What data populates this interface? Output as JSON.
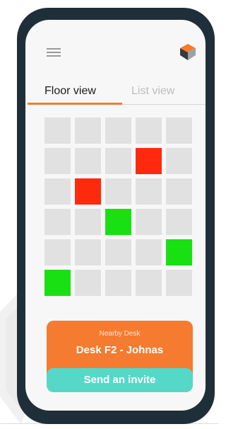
{
  "tabs": [
    {
      "label": "Floor view",
      "active": true
    },
    {
      "label": "List view",
      "active": false
    }
  ],
  "icons": {
    "menu": "hamburger-menu-icon",
    "logo": "cube-logo-icon"
  },
  "colors": {
    "phone_frame": "#1f2f39",
    "screen_bg": "#f7f7f7",
    "accent": "#f27c36",
    "desk_free": "#e1e1e1",
    "desk_occupied": "#ff2a0e",
    "desk_available": "#19e012",
    "card": "#f47b30",
    "button": "#56d8c8"
  },
  "floor": {
    "rows": 6,
    "columns": 5,
    "desks": [
      [
        "free",
        "free",
        "free",
        "free",
        "free"
      ],
      [
        "free",
        "free",
        "free",
        "occupied",
        "free"
      ],
      [
        "free",
        "occupied",
        "free",
        "free",
        "free"
      ],
      [
        "free",
        "free",
        "available",
        "free",
        "free"
      ],
      [
        "free",
        "free",
        "free",
        "free",
        "available"
      ],
      [
        "available",
        "free",
        "free",
        "free",
        "free"
      ]
    ]
  },
  "nearby_card": {
    "subtitle": "Nearby Desk",
    "title": "Desk F2 - Johnas",
    "button_label": "Send an invite"
  }
}
